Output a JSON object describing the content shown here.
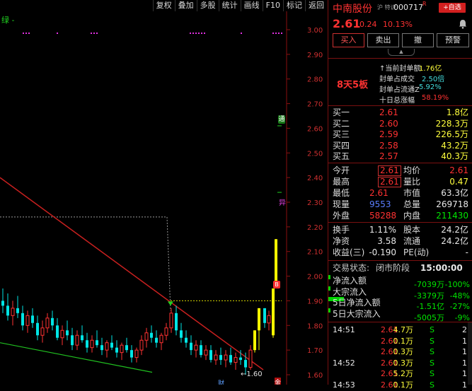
{
  "toolbar": {
    "buttons": [
      "复权",
      "叠加",
      "多股",
      "统计",
      "画线",
      "F10",
      "标记",
      "返回"
    ],
    "indicator_label": "绿 -"
  },
  "chart_data": {
    "type": "candlestick",
    "y_ticks": [
      "3.00",
      "2.90",
      "2.80",
      "2.70",
      "2.60",
      "2.50",
      "2.40",
      "2.30",
      "2.20",
      "2.10",
      "2.00",
      "1.90",
      "1.80",
      "1.70",
      "1.60"
    ],
    "ylim": [
      1.58,
      3.02
    ],
    "low_annotation": "←1.60",
    "markers": {
      "tong": "通",
      "yi": "异",
      "b": "B",
      "cai": "财",
      "jin": "金"
    },
    "colors": {
      "up": "#ff3232",
      "down": "#00e5e5",
      "limit": "#ffff00",
      "trend": "#c8201f",
      "support": "#20c020"
    },
    "candles": [
      {
        "o": 1.9,
        "h": 1.95,
        "l": 1.85,
        "c": 1.88
      },
      {
        "o": 1.88,
        "h": 1.93,
        "l": 1.82,
        "c": 1.84
      },
      {
        "o": 1.84,
        "h": 1.9,
        "l": 1.8,
        "c": 1.87
      },
      {
        "o": 1.87,
        "h": 1.92,
        "l": 1.83,
        "c": 1.85
      },
      {
        "o": 1.85,
        "h": 1.88,
        "l": 1.78,
        "c": 1.8
      },
      {
        "o": 1.8,
        "h": 1.86,
        "l": 1.77,
        "c": 1.84
      },
      {
        "o": 1.84,
        "h": 1.87,
        "l": 1.79,
        "c": 1.81
      },
      {
        "o": 1.81,
        "h": 1.84,
        "l": 1.74,
        "c": 1.76
      },
      {
        "o": 1.76,
        "h": 1.82,
        "l": 1.73,
        "c": 1.79
      },
      {
        "o": 1.79,
        "h": 1.85,
        "l": 1.77,
        "c": 1.83
      },
      {
        "o": 1.83,
        "h": 1.86,
        "l": 1.78,
        "c": 1.8
      },
      {
        "o": 1.8,
        "h": 1.83,
        "l": 1.74,
        "c": 1.75
      },
      {
        "o": 1.75,
        "h": 1.8,
        "l": 1.72,
        "c": 1.78
      },
      {
        "o": 1.78,
        "h": 1.82,
        "l": 1.74,
        "c": 1.76
      },
      {
        "o": 1.76,
        "h": 1.79,
        "l": 1.7,
        "c": 1.72
      },
      {
        "o": 1.72,
        "h": 1.78,
        "l": 1.7,
        "c": 1.76
      },
      {
        "o": 1.76,
        "h": 1.8,
        "l": 1.73,
        "c": 1.74
      },
      {
        "o": 1.74,
        "h": 1.77,
        "l": 1.69,
        "c": 1.71
      },
      {
        "o": 1.71,
        "h": 1.76,
        "l": 1.69,
        "c": 1.74
      },
      {
        "o": 1.74,
        "h": 1.78,
        "l": 1.71,
        "c": 1.72
      },
      {
        "o": 1.72,
        "h": 1.75,
        "l": 1.68,
        "c": 1.7
      },
      {
        "o": 1.7,
        "h": 1.74,
        "l": 1.67,
        "c": 1.73
      },
      {
        "o": 1.73,
        "h": 1.76,
        "l": 1.7,
        "c": 1.71
      },
      {
        "o": 1.71,
        "h": 1.74,
        "l": 1.67,
        "c": 1.69
      },
      {
        "o": 1.69,
        "h": 1.73,
        "l": 1.66,
        "c": 1.72
      },
      {
        "o": 1.72,
        "h": 1.75,
        "l": 1.69,
        "c": 1.7
      },
      {
        "o": 1.7,
        "h": 1.72,
        "l": 1.65,
        "c": 1.67
      },
      {
        "o": 1.67,
        "h": 1.71,
        "l": 1.65,
        "c": 1.7
      },
      {
        "o": 1.7,
        "h": 1.76,
        "l": 1.68,
        "c": 1.74
      },
      {
        "o": 1.74,
        "h": 1.79,
        "l": 1.71,
        "c": 1.77
      },
      {
        "o": 1.77,
        "h": 1.8,
        "l": 1.73,
        "c": 1.75
      },
      {
        "o": 1.75,
        "h": 1.78,
        "l": 1.71,
        "c": 1.73
      },
      {
        "o": 1.73,
        "h": 1.77,
        "l": 1.7,
        "c": 1.76
      },
      {
        "o": 1.76,
        "h": 1.81,
        "l": 1.74,
        "c": 1.79
      },
      {
        "o": 1.79,
        "h": 1.87,
        "l": 1.77,
        "c": 1.85
      },
      {
        "o": 1.85,
        "h": 1.88,
        "l": 1.76,
        "c": 1.78
      },
      {
        "o": 1.78,
        "h": 1.81,
        "l": 1.73,
        "c": 1.75
      },
      {
        "o": 1.75,
        "h": 1.78,
        "l": 1.71,
        "c": 1.73
      },
      {
        "o": 1.73,
        "h": 1.76,
        "l": 1.68,
        "c": 1.7
      },
      {
        "o": 1.7,
        "h": 1.74,
        "l": 1.67,
        "c": 1.72
      },
      {
        "o": 1.72,
        "h": 1.74,
        "l": 1.67,
        "c": 1.68
      },
      {
        "o": 1.68,
        "h": 1.72,
        "l": 1.66,
        "c": 1.7
      },
      {
        "o": 1.7,
        "h": 1.72,
        "l": 1.65,
        "c": 1.66
      },
      {
        "o": 1.66,
        "h": 1.7,
        "l": 1.64,
        "c": 1.68
      },
      {
        "o": 1.68,
        "h": 1.71,
        "l": 1.64,
        "c": 1.66
      },
      {
        "o": 1.66,
        "h": 1.7,
        "l": 1.63,
        "c": 1.68
      },
      {
        "o": 1.68,
        "h": 1.71,
        "l": 1.64,
        "c": 1.65
      },
      {
        "o": 1.65,
        "h": 1.69,
        "l": 1.62,
        "c": 1.67
      },
      {
        "o": 1.67,
        "h": 1.7,
        "l": 1.64,
        "c": 1.66
      },
      {
        "o": 1.66,
        "h": 1.69,
        "l": 1.6,
        "c": 1.63
      },
      {
        "o": 1.63,
        "h": 1.72,
        "l": 1.62,
        "c": 1.7
      },
      {
        "o": 1.7,
        "h": 1.78,
        "l": 1.69,
        "c": 1.78,
        "limit": true
      },
      {
        "o": 1.78,
        "h": 1.87,
        "l": 1.7,
        "c": 1.87,
        "limit": true
      },
      {
        "o": 1.87,
        "h": 1.87,
        "l": 1.79,
        "c": 1.81
      },
      {
        "o": 1.81,
        "h": 1.86,
        "l": 1.78,
        "c": 1.84
      },
      {
        "o": 1.76,
        "h": 1.95,
        "l": 1.75,
        "c": 1.95,
        "limit": true
      },
      {
        "o": 1.95,
        "h": 2.15,
        "l": 1.95,
        "c": 2.15,
        "limit": true
      }
    ]
  },
  "stock": {
    "name": "中南股份",
    "tag": "沪 特识",
    "code": "000717",
    "code_badge": "R",
    "add_button": "+自选",
    "bell": "bell-icon",
    "price": "2.61",
    "change": "0.24",
    "change_pct": "10.13%"
  },
  "actions": [
    "买入",
    "卖出",
    "撤",
    "预警"
  ],
  "summary": {
    "streak": "8天5板",
    "lines": [
      {
        "label": "↑当前封单额",
        "value": "1.76亿",
        "color": "yellow"
      },
      {
        "label": "封单占成交",
        "value": "2.50倍",
        "color": "cyan"
      },
      {
        "label": "封单占流通Z",
        "value": "5.92%",
        "color": "cyan"
      },
      {
        "label": "十日总涨幅",
        "value": "58.19%",
        "color": "red"
      }
    ]
  },
  "order_book": [
    {
      "label": "买一",
      "price": "2.61",
      "vol": "1.8亿"
    },
    {
      "label": "买二",
      "price": "2.60",
      "vol": "228.3万"
    },
    {
      "label": "买三",
      "price": "2.59",
      "vol": "226.5万"
    },
    {
      "label": "买四",
      "price": "2.58",
      "vol": "43.2万"
    },
    {
      "label": "买五",
      "price": "2.57",
      "vol": "40.3万"
    }
  ],
  "quote": [
    {
      "l1": "今开",
      "v1": "2.61",
      "c1": "red",
      "l2": "均价",
      "v2": "2.61",
      "c2": "red",
      "box1": true
    },
    {
      "l1": "最高",
      "v1": "2.61",
      "c1": "red",
      "l2": "量比",
      "v2": "0.47",
      "c2": "yellow",
      "box1": true
    },
    {
      "l1": "最低",
      "v1": "2.61",
      "c1": "red",
      "l2": "市值",
      "v2": "63.3亿",
      "c2": "white"
    },
    {
      "l1": "现量",
      "v1": "9553",
      "c1": "blue",
      "l2": "总量",
      "v2": "269718",
      "c2": "white"
    },
    {
      "l1": "外盘",
      "v1": "58288",
      "c1": "red",
      "l2": "内盘",
      "v2": "211430",
      "c2": "green"
    }
  ],
  "stats": [
    {
      "l1": "换手",
      "v1": "1.11%",
      "l2": "股本",
      "v2": "24.2亿"
    },
    {
      "l1": "净资",
      "v1": "3.58",
      "l2": "流通",
      "v2": "24.2亿"
    },
    {
      "l1": "收益(三)",
      "v1": "-0.190",
      "l2": "PE(动)",
      "v2": "-"
    }
  ],
  "trade_status": {
    "label": "交易状态:",
    "status": "闭市阶段",
    "time": "15:00:00"
  },
  "flows": [
    {
      "label": "净流入额",
      "value": "-7039万",
      "pct": "-100%",
      "bar": 0.05
    },
    {
      "label": "大宗流入",
      "value": "-3379万",
      "pct": "-48%",
      "bar": 0.03
    },
    {
      "label": "5日净流入额",
      "value": "-1.51亿",
      "pct": "-27%",
      "bar": 1.0
    },
    {
      "label": "5日大宗流入",
      "value": "-5005万",
      "pct": "-9%",
      "bar": 0.03
    }
  ],
  "ticks": [
    {
      "time": "14:51",
      "price": "2.61",
      "vol": "4.7万",
      "side": "S",
      "n": "2"
    },
    {
      "time": "",
      "price": "2.61",
      "vol": "0.1万",
      "side": "S",
      "n": "1"
    },
    {
      "time": "",
      "price": "2.61",
      "vol": "0.3万",
      "side": "S",
      "n": "1"
    },
    {
      "time": "14:52",
      "price": "2.61",
      "vol": "0.3万",
      "side": "S",
      "n": "1"
    },
    {
      "time": "",
      "price": "2.61",
      "vol": "5.2万",
      "side": "S",
      "n": "1"
    },
    {
      "time": "14:53",
      "price": "2.61",
      "vol": "0.1万",
      "side": "S",
      "n": "1"
    }
  ]
}
